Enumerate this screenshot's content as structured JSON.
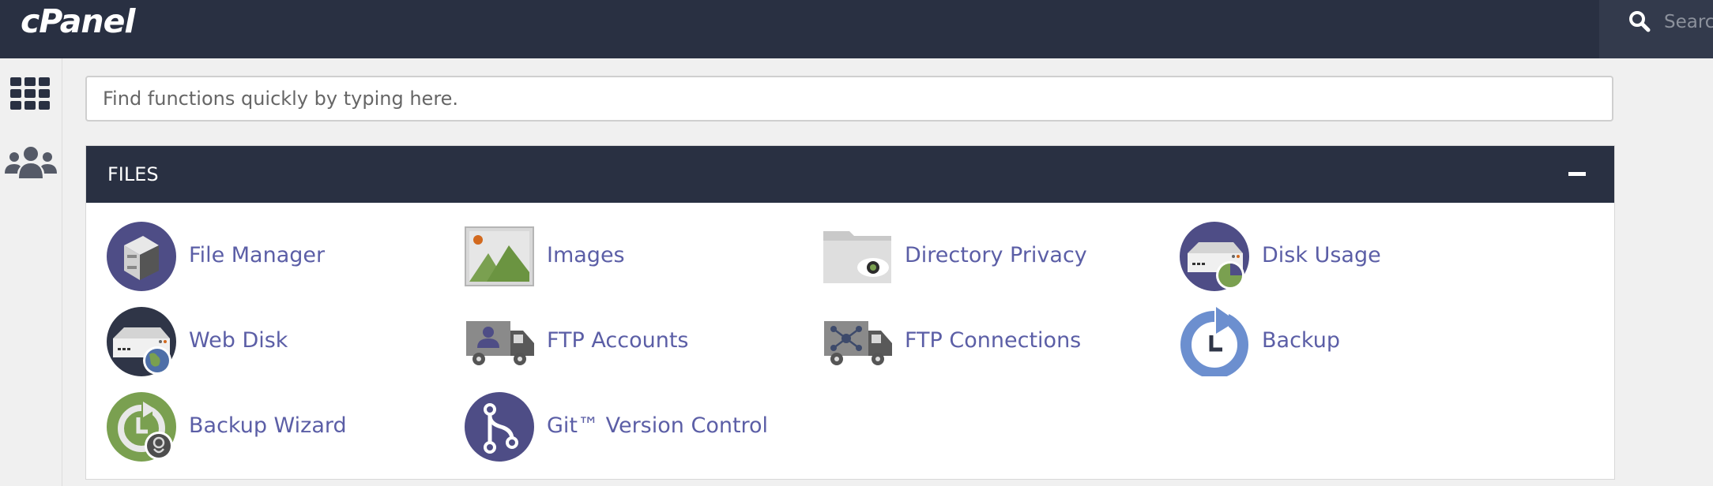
{
  "app": {
    "logo_text": "cPanel"
  },
  "topbar": {
    "search_label": "Search",
    "search_icon": "search-icon"
  },
  "sidebar": {
    "items": [
      {
        "icon": "grid-icon"
      },
      {
        "icon": "users-icon"
      }
    ]
  },
  "quick_search": {
    "placeholder": "Find functions quickly by typing here."
  },
  "files_section": {
    "title": "FILES",
    "collapse_icon": "minus-icon",
    "tools": [
      {
        "label": "File Manager",
        "icon": "file-manager-icon"
      },
      {
        "label": "Images",
        "icon": "images-icon"
      },
      {
        "label": "Directory Privacy",
        "icon": "directory-privacy-icon"
      },
      {
        "label": "Disk Usage",
        "icon": "disk-usage-icon"
      },
      {
        "label": "Web Disk",
        "icon": "web-disk-icon"
      },
      {
        "label": "FTP Accounts",
        "icon": "ftp-accounts-icon"
      },
      {
        "label": "FTP Connections",
        "icon": "ftp-connections-icon"
      },
      {
        "label": "Backup",
        "icon": "backup-icon"
      },
      {
        "label": "Backup Wizard",
        "icon": "backup-wizard-icon"
      },
      {
        "label": "Git™ Version Control",
        "icon": "git-version-control-icon"
      }
    ]
  },
  "colors": {
    "topbar_bg": "#293042",
    "link": "#5b5ea6",
    "icon_purple": "#4e4d86",
    "icon_green": "#7aa050"
  }
}
